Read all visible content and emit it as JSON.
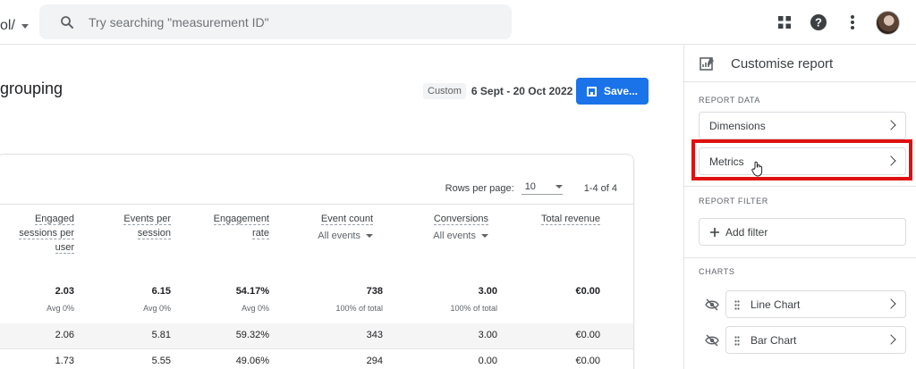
{
  "header": {
    "property_selector": "ol/",
    "search_placeholder": "Try searching \"measurement ID\""
  },
  "page": {
    "title": "grouping",
    "date_chip": "Custom",
    "date_range": "6 Sept - 20 Oct 2022",
    "save_label": "Save..."
  },
  "table": {
    "rows_per_page_label": "Rows per page:",
    "rows_per_page_value": "10",
    "pagination": "1-4 of 4",
    "columns": [
      {
        "label": "Engaged sessions per user",
        "sub": ""
      },
      {
        "label": "Events per session",
        "sub": ""
      },
      {
        "label": "Engagement rate",
        "sub": ""
      },
      {
        "label": "Event count",
        "sub": "All events"
      },
      {
        "label": "Conversions",
        "sub": "All events"
      },
      {
        "label": "Total revenue",
        "sub": ""
      }
    ],
    "totals": [
      "2.03",
      "6.15",
      "54.17%",
      "738",
      "3.00",
      "€0.00"
    ],
    "totals_sub": [
      "Avg 0%",
      "Avg 0%",
      "Avg 0%",
      "100% of total",
      "100% of total",
      ""
    ],
    "rows": [
      [
        "2.06",
        "5.81",
        "59.32%",
        "343",
        "3.00",
        "€0.00"
      ],
      [
        "1.73",
        "5.55",
        "49.06%",
        "294",
        "0.00",
        "€0.00"
      ]
    ]
  },
  "panel": {
    "title": "Customise report",
    "report_data_label": "REPORT DATA",
    "dimensions_label": "Dimensions",
    "metrics_label": "Metrics",
    "report_filter_label": "REPORT FILTER",
    "add_filter_label": "Add filter",
    "charts_label": "CHARTS",
    "line_chart_label": "Line Chart",
    "bar_chart_label": "Bar Chart"
  },
  "colors": {
    "accent": "#1a73e8",
    "highlight": "#e01010"
  },
  "icons": [
    "search-icon",
    "apps-grid-icon",
    "help-icon",
    "more-vert-icon",
    "avatar",
    "save-icon",
    "customise-report-icon",
    "chevron-right-icon",
    "plus-icon",
    "hidden-eye-icon",
    "drag-handle-icon",
    "hand-cursor-icon"
  ]
}
